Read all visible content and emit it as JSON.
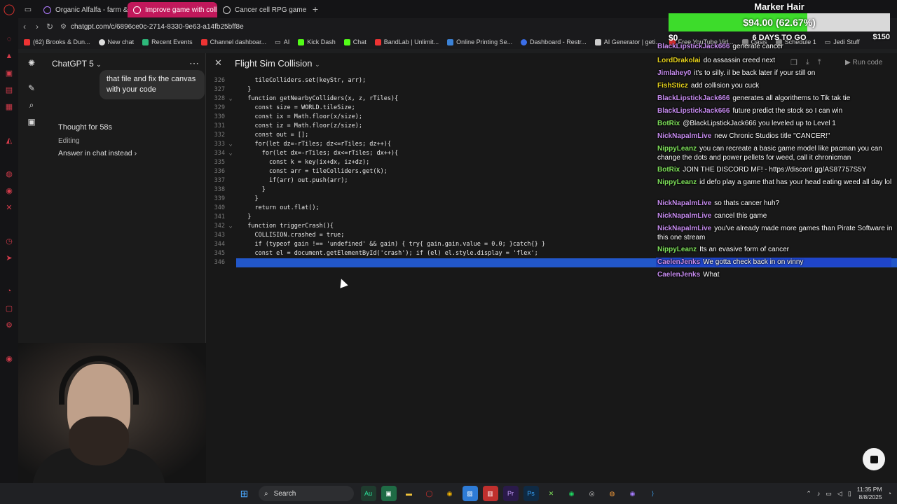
{
  "browser": {
    "tabs": [
      {
        "label": "Organic Alfalfa - farm & g",
        "active": false
      },
      {
        "label": "Improve game with collis",
        "active": true
      },
      {
        "label": "Cancer cell RPG game",
        "active": false
      }
    ],
    "url": "chatgpt.com/c/6896ce0c-2714-8330-9e63-a14fb25bff8e",
    "bookmarks": [
      "(62) Brooks & Dun...",
      "New chat",
      "Recent Events",
      "Channel dashboar...",
      "AI",
      "Kick Dash",
      "Chat",
      "BandLab | Unlimit...",
      "Online Printing Se...",
      "Dashboard - Restr...",
      "AI Generator | geti...",
      "Free YouTube Vid...",
      "Oasis",
      "Schedule 1",
      "Jedi Stuff"
    ]
  },
  "sidebar": {
    "model": "ChatGPT 5",
    "user_message": "that file and fix the canvas with your code",
    "thought": "Thought for 58s",
    "status": "Editing",
    "answer_link": "Answer in chat instead"
  },
  "canvas": {
    "title": "Flight Sim Collision",
    "run_label": "Run code",
    "lines": [
      {
        "n": "326",
        "fold": "",
        "code": "    tileColliders.set(keyStr, arr);"
      },
      {
        "n": "327",
        "fold": "",
        "code": "  }"
      },
      {
        "n": "328",
        "fold": "⌄",
        "code": "  function getNearbyColliders(x, z, rTiles){"
      },
      {
        "n": "329",
        "fold": "",
        "code": "    const size = WORLD.tileSize;"
      },
      {
        "n": "330",
        "fold": "",
        "code": "    const ix = Math.floor(x/size);"
      },
      {
        "n": "331",
        "fold": "",
        "code": "    const iz = Math.floor(z/size);"
      },
      {
        "n": "332",
        "fold": "",
        "code": "    const out = [];"
      },
      {
        "n": "333",
        "fold": "⌄",
        "code": "    for(let dz=-rTiles; dz<=rTiles; dz++){"
      },
      {
        "n": "334",
        "fold": "⌄",
        "code": "      for(let dx=-rTiles; dx<=rTiles; dx++){"
      },
      {
        "n": "335",
        "fold": "",
        "code": "        const k = key(ix+dx, iz+dz);"
      },
      {
        "n": "336",
        "fold": "",
        "code": "        const arr = tileColliders.get(k);"
      },
      {
        "n": "337",
        "fold": "",
        "code": "        if(arr) out.push(arr);"
      },
      {
        "n": "338",
        "fold": "",
        "code": "      }"
      },
      {
        "n": "339",
        "fold": "",
        "code": "    }"
      },
      {
        "n": "340",
        "fold": "",
        "code": "    return out.flat();"
      },
      {
        "n": "341",
        "fold": "",
        "code": "  }"
      },
      {
        "n": "342",
        "fold": "⌄",
        "code": "  function triggerCrash(){"
      },
      {
        "n": "343",
        "fold": "",
        "code": "    COLLISION.crashed = true;"
      },
      {
        "n": "344",
        "fold": "",
        "code": "    if (typeof gain !== 'undefined' && gain) { try{ gain.gain.value = 0.0; }catch{} }"
      },
      {
        "n": "345",
        "fold": "",
        "code": "    const el = document.getElementById('crash'); if (el) el.style.display = 'flex';"
      },
      {
        "n": "346",
        "fold": "",
        "code": ""
      }
    ]
  },
  "chat_overlay": {
    "messages": [
      {
        "user": "BlackLipstickJack666",
        "text": "generate cancer",
        "color": "#c78cf0"
      },
      {
        "user": "LordDrakolai",
        "text": "do assassin creed next",
        "color": "#e6d21c"
      },
      {
        "user": "Jimlahey0",
        "text": "it's to silly. il be back later if your still on",
        "color": "#c78cf0"
      },
      {
        "user": "FishSticz",
        "text": "add collision you cuck",
        "color": "#e6d21c"
      },
      {
        "user": "BlackLipstickJack666",
        "text": "generates all algorithems to Tik tak tie",
        "color": "#c78cf0"
      },
      {
        "user": "BlackLipstickJack666",
        "text": "future predict the stock so I can win",
        "color": "#c78cf0"
      },
      {
        "user": "BotRix",
        "text": "@BlackLipstickJack666 you leveled up to Level 1",
        "color": "#7ee05a"
      },
      {
        "user": "NickNapalmLive",
        "text": "new Chronic Studios title \"CANCER!\"",
        "color": "#c78cf0"
      },
      {
        "user": "NippyLeanz",
        "text": "you can recreate a basic game model like pacman you can change the dots and power pellets for weed, call it chronicman",
        "color": "#7ee05a"
      },
      {
        "user": "BotRix",
        "text": "JOIN THE DISCORD MF! - https://discord.gg/AS87757S5Y",
        "color": "#7ee05a"
      },
      {
        "user": "NippyLeanz",
        "text": "id defo play a game that has your head eating weed all day lol",
        "color": "#7ee05a"
      },
      {
        "user": "NickNapalmLive",
        "text": "so thats cancer huh?",
        "color": "#c78cf0"
      },
      {
        "user": "NickNapalmLive",
        "text": "cancel this game",
        "color": "#c78cf0"
      },
      {
        "user": "NickNapalmLive",
        "text": "you've already made more games than Pirate Software in this one stream",
        "color": "#c78cf0"
      },
      {
        "user": "NippyLeanz",
        "text": "Its an evasive form of cancer",
        "color": "#7ee05a"
      },
      {
        "user": "CaelenJenks",
        "text": "We gotta check back in on vinny",
        "color": "#c78cf0"
      },
      {
        "user": "CaelenJenks",
        "text": "What",
        "color": "#c78cf0"
      }
    ]
  },
  "marker_widget": {
    "title": "Marker Hair",
    "amount": "$94.00 (62.67%)",
    "progress": 0.6267,
    "min": "$0",
    "countdown": "6 DAYS TO GO",
    "max": "$150"
  },
  "taskbar": {
    "search_placeholder": "Search",
    "time": "11:35 PM",
    "date": "8/8/2025"
  },
  "colors": {
    "active_tab": "#c1185b",
    "selection": "#2257c9",
    "progress_fill": "#3ddc2b"
  }
}
